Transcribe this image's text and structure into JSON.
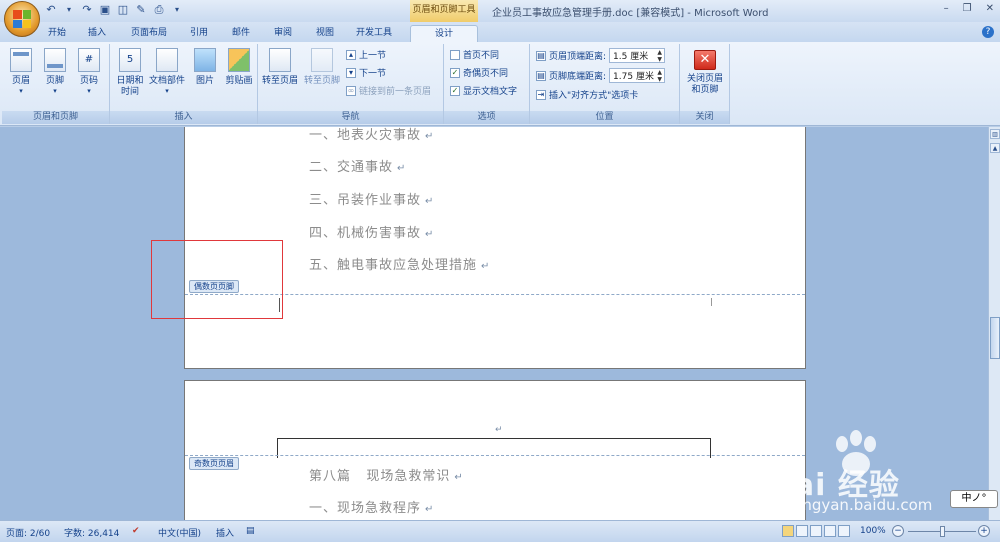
{
  "titlebar": {
    "context_tool": "页眉和页脚工具",
    "doc_title": "企业员工事故应急管理手册.doc [兼容模式] - Microsoft Word"
  },
  "tabs": [
    {
      "label": "开始"
    },
    {
      "label": "插入"
    },
    {
      "label": "页面布局"
    },
    {
      "label": "引用"
    },
    {
      "label": "邮件"
    },
    {
      "label": "审阅"
    },
    {
      "label": "视图"
    },
    {
      "label": "开发工具"
    },
    {
      "label": "设计"
    }
  ],
  "ribbon": {
    "groups": {
      "header_footer": "页眉和页脚",
      "insert": "插入",
      "navigation": "导航",
      "options": "选项",
      "position": "位置",
      "close": "关闭"
    },
    "header_btn": "页眉",
    "footer_btn": "页脚",
    "pagenum_btn": "页码",
    "datetime_btn": "日期和\n时间",
    "docparts_btn": "文档部件",
    "picture_btn": "图片",
    "clipart_btn": "剪贴画",
    "goto_header_btn": "转至页眉",
    "goto_footer_btn": "转至页脚",
    "prev_section": "上一节",
    "next_section": "下一节",
    "link_previous": "链接到前一条页眉",
    "opt_first_page": "首页不同",
    "opt_odd_even": "奇偶页不同",
    "opt_show_text": "显示文档文字",
    "header_top_label": "页眉顶端距离:",
    "header_top_value": "1.5 厘米",
    "footer_bottom_label": "页脚底端距离:",
    "footer_bottom_value": "1.75 厘米",
    "insert_align_tab": "插入\"对齐方式\"选项卡",
    "close_btn": "关闭页眉\n和页脚"
  },
  "document": {
    "page1_lines": [
      "一、地表火灾事故",
      "二、交通事故",
      "三、吊装作业事故",
      "四、机械伤害事故",
      "五、触电事故应急处理措施"
    ],
    "even_footer_tag": "偶数页页脚",
    "odd_header_tag": "奇数页页眉",
    "page2_lines": [
      "第八篇   现场急救常识",
      "一、现场急救程序"
    ],
    "paragraph_mark": "↵"
  },
  "watermark": {
    "brand": "Bai 经验",
    "url": "jingyan.baidu.com"
  },
  "ime": "中ノ°",
  "statusbar": {
    "page": "页面: 2/60",
    "words": "字数: 26,414",
    "language": "中文(中国)",
    "insert_mode": "插入",
    "zoom": "100%"
  },
  "colors": {
    "highlight": "#e0383b",
    "context_tab": "#f0cc6a"
  }
}
